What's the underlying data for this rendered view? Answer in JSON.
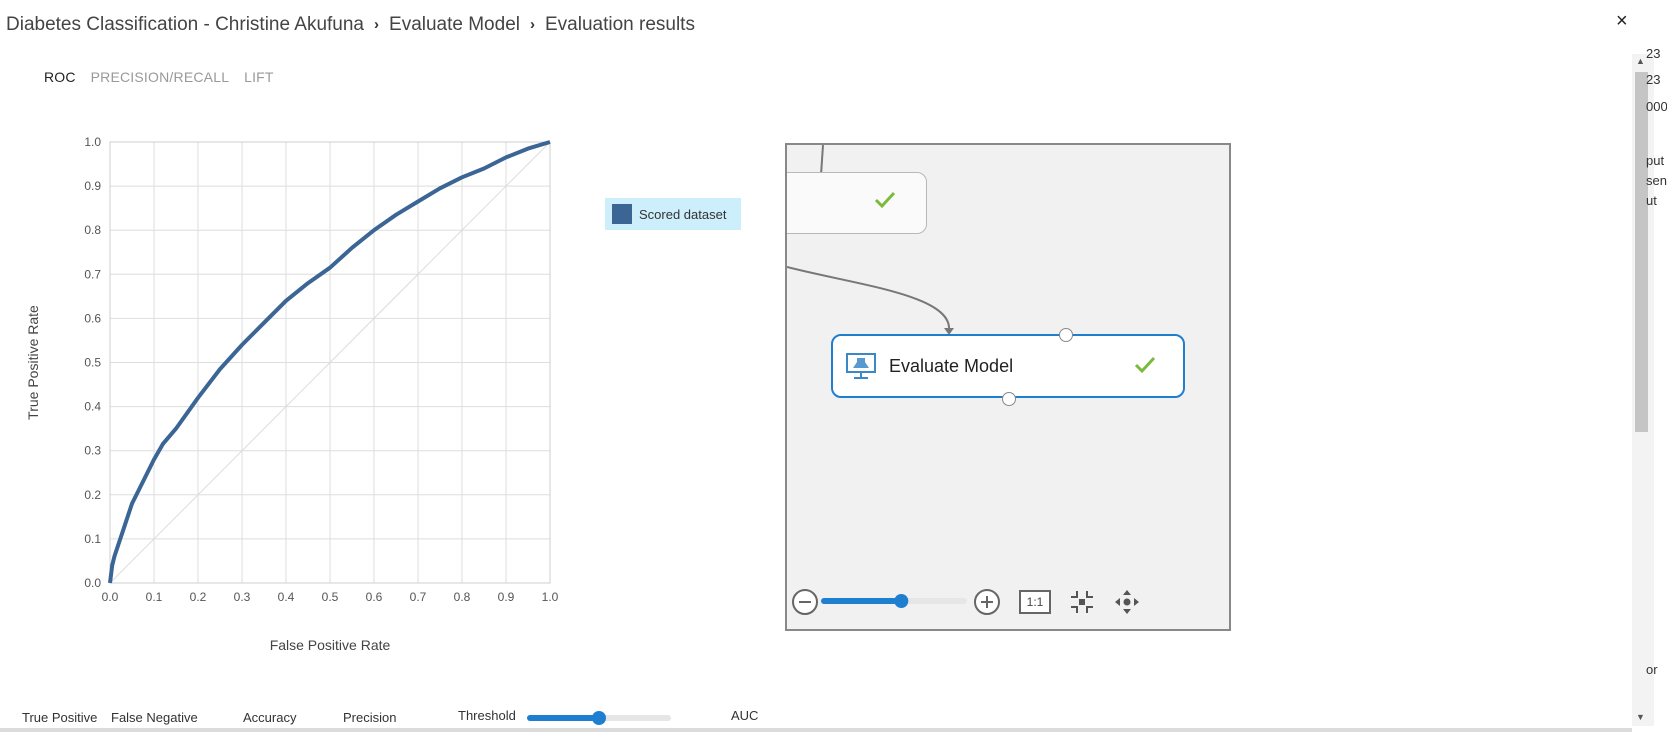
{
  "breadcrumb": {
    "experiment": "Diabetes Classification - Christine Akufuna",
    "module": "Evaluate Model",
    "page": "Evaluation results"
  },
  "close_label": "×",
  "tabs": [
    {
      "label": "ROC",
      "active": true
    },
    {
      "label": "PRECISION/RECALL",
      "active": false
    },
    {
      "label": "LIFT",
      "active": false
    }
  ],
  "legend": {
    "label": "Scored dataset",
    "color": "#3a6595"
  },
  "chart_data": {
    "type": "line",
    "xlabel": "False Positive Rate",
    "ylabel": "True Positive Rate",
    "xlim": [
      0,
      1
    ],
    "ylim": [
      0,
      1
    ],
    "xticks": [
      "0.0",
      "0.1",
      "0.2",
      "0.3",
      "0.4",
      "0.5",
      "0.6",
      "0.7",
      "0.8",
      "0.9",
      "1.0"
    ],
    "yticks": [
      "0.0",
      "0.1",
      "0.2",
      "0.3",
      "0.4",
      "0.5",
      "0.6",
      "0.7",
      "0.8",
      "0.9",
      "1.0"
    ],
    "grid": true,
    "diagonal": true,
    "series": [
      {
        "name": "Scored dataset",
        "color": "#3a6595",
        "x": [
          0.0,
          0.005,
          0.01,
          0.02,
          0.03,
          0.05,
          0.07,
          0.1,
          0.12,
          0.15,
          0.2,
          0.25,
          0.3,
          0.35,
          0.4,
          0.45,
          0.5,
          0.55,
          0.6,
          0.65,
          0.7,
          0.75,
          0.8,
          0.85,
          0.9,
          0.95,
          1.0
        ],
        "y": [
          0.0,
          0.04,
          0.06,
          0.09,
          0.12,
          0.18,
          0.22,
          0.28,
          0.315,
          0.35,
          0.42,
          0.485,
          0.54,
          0.59,
          0.64,
          0.68,
          0.715,
          0.76,
          0.8,
          0.835,
          0.865,
          0.895,
          0.92,
          0.94,
          0.965,
          0.985,
          1.0
        ]
      }
    ]
  },
  "canvas": {
    "module_label": "Evaluate Model",
    "zoom_level": 0.55,
    "zoom_reset_label": "1:1"
  },
  "peek_text": [
    "23",
    "23",
    "000",
    "put",
    "sen",
    "ut",
    "or"
  ],
  "metrics": {
    "true_positive": "True Positive",
    "false_negative": "False Negative",
    "accuracy": "Accuracy",
    "precision": "Precision",
    "threshold": "Threshold",
    "threshold_value": 0.5,
    "auc": "AUC"
  },
  "colors": {
    "accent": "#1e7fd0",
    "success": "#7cba3d",
    "curve": "#3a6595"
  }
}
